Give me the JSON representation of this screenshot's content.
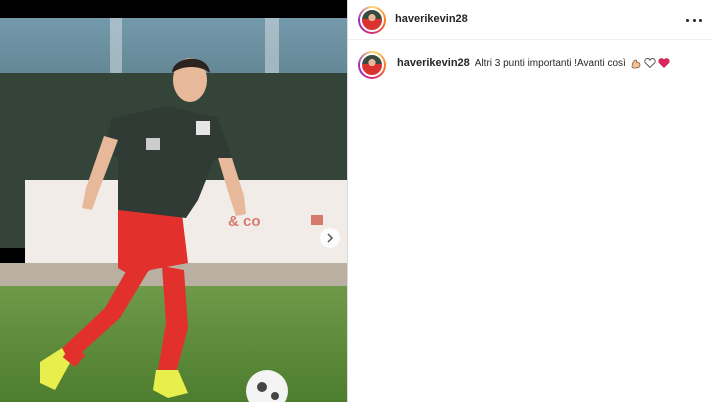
{
  "post": {
    "username": "haverikevin28",
    "photo_alt": "Soccer player in green jersey and red shorts on pitch",
    "carousel_next_icon": "chevron-right-icon"
  },
  "header": {
    "username": "haverikevin28",
    "more_icon": "more-horizontal-icon"
  },
  "comment": {
    "username": "haverikevin28",
    "text": "Altri 3 punti importanti !Avanti così",
    "emojis": [
      "flexed-biceps-icon",
      "white-heart-icon",
      "red-heart-icon"
    ]
  },
  "colors": {
    "jersey": "#2f3b34",
    "shorts": "#e2302c",
    "pitch": "#5d8a3a",
    "text": "#262626"
  }
}
